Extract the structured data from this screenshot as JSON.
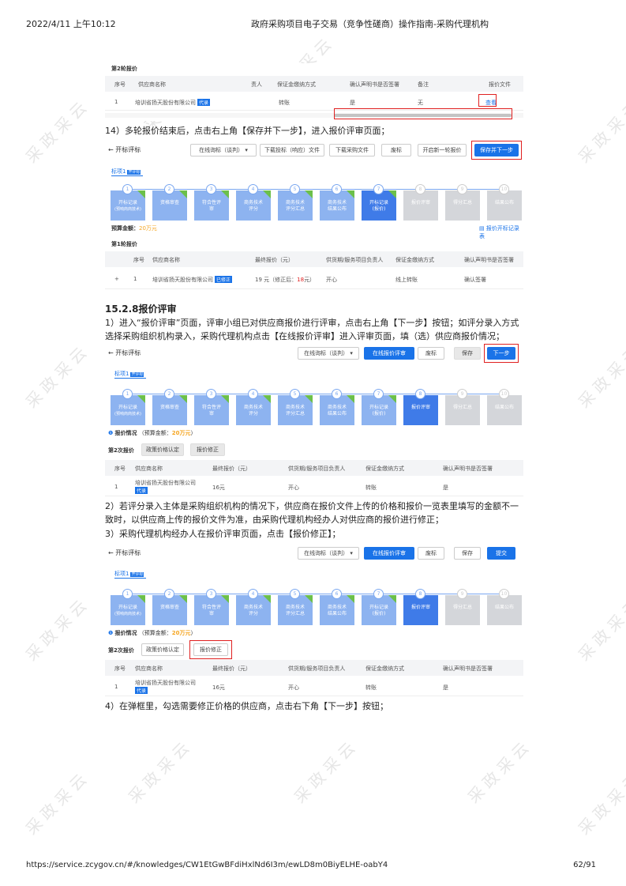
{
  "header": {
    "datetime": "2022/4/11 上午10:12",
    "title": "政府采购项目电子交易（竞争性磋商）操作指南-采购代理机构"
  },
  "footer": {
    "url": "https://service.zcygov.cn/#/knowledges/CW1EtGwBFdiHxlNd6I3m/ewLD8m0BiyELHE-oabY4",
    "page": "62/91"
  },
  "watermark": "采政采云",
  "shot1": {
    "round_label": "第2轮报价",
    "headers": [
      "序号",
      "供应商名称",
      "责人",
      "保证金缴纳方式",
      "确认声明书是否签署",
      "备注",
      "报价文件"
    ],
    "row": {
      "no": "1",
      "supplier": "培训省扬天股份有限公司",
      "tag": "代录",
      "method": "转账",
      "signed": "是",
      "remark": "无",
      "action": "查看"
    }
  },
  "p14": "14）多轮报价结束后，点击右上角【保存并下一步】，进入报价评审页面；",
  "shot2": {
    "back": "开标评标",
    "buttons": [
      "在线询标（谈判）",
      "下载投标（响应）文件",
      "下载采购文件",
      "废标",
      "开启新一轮报价",
      "保存并下一步"
    ],
    "tab": "标项1",
    "tab_badge": "开评标",
    "steps": [
      {
        "n": "1",
        "l1": "开标记录",
        "l2": "(预响商商技术)"
      },
      {
        "n": "2",
        "l1": "资格审查",
        "l2": ""
      },
      {
        "n": "3",
        "l1": "符合性评",
        "l2": "审"
      },
      {
        "n": "4",
        "l1": "商务技术",
        "l2": "评分"
      },
      {
        "n": "5",
        "l1": "商务技术",
        "l2": "评分汇总"
      },
      {
        "n": "6",
        "l1": "商务技术",
        "l2": "结果公布"
      },
      {
        "n": "7",
        "l1": "开标记录",
        "l2": "(报价)"
      },
      {
        "n": "8",
        "l1": "报价评审",
        "l2": ""
      },
      {
        "n": "9",
        "l1": "得分汇总",
        "l2": ""
      },
      {
        "n": "10",
        "l1": "结果公布",
        "l2": ""
      }
    ],
    "budget_label": "预算金额：",
    "budget": "20万元",
    "record_link": "报价开标记录表",
    "round": "第1轮报价",
    "headers": [
      "序号",
      "供应商名称",
      "最终报价（元）",
      "供货期/服务项目负责人",
      "保证金缴纳方式",
      "确认声明书是否签署"
    ],
    "row": {
      "expand": "+",
      "no": "1",
      "supplier": "培训省扬天股份有限公司",
      "tag": "已修正",
      "price": "19 元（修正后：",
      "price_red": "18",
      "price_end": "元）",
      "person": "开心",
      "method": "线上转账",
      "signed": "确认签署"
    }
  },
  "section_title": "15.2.8报价评审",
  "p1": "1）进入“报价评审”页面，评审小组已对供应商报价进行评审，点击右上角【下一步】按钮；如评分录入方式选择采购组织机构录入，采购代理机构点击【在线报价评审】进入评审页面，填（选）供应商报价情况；",
  "shot3": {
    "back": "开标评标",
    "buttons": [
      "在线询标（谈判）",
      "在线报价评审",
      "废标",
      "保存",
      "下一步"
    ],
    "tab": "标项1",
    "tab_badge": "开评标",
    "info_label": "报价情况",
    "budget_text": "（预算金额：",
    "budget": "20万元",
    "budget_end": "）",
    "round": "第2次报价",
    "tabs": [
      "政策价格认定",
      "报价修正"
    ],
    "headers": [
      "序号",
      "供应商名称",
      "最终报价（元）",
      "供货期/服务项目负责人",
      "保证金缴纳方式",
      "确认声明书是否签署"
    ],
    "row": {
      "no": "1",
      "supplier": "培训省扬天股份有限公司",
      "tag": "代录",
      "price": "16元",
      "person": "开心",
      "method": "转账",
      "signed": "是"
    }
  },
  "p2": "2）若评分录入主体是采购组织机构的情况下，供应商在报价文件上传的价格和报价一览表里填写的金额不一致时，以供应商上传的报价文件为准，由采购代理机构经办人对供应商的报价进行修正；",
  "p3": "3）采购代理机构经办人在报价评审页面，点击【报价修正】；",
  "shot4": {
    "back": "开标评标",
    "buttons": [
      "在线询标（谈判）",
      "在线报价评审",
      "废标",
      "保存",
      "提交"
    ],
    "tab": "标项1",
    "tab_badge": "开评标",
    "info_label": "报价情况",
    "budget_text": "（预算金额：",
    "budget": "20万元",
    "budget_end": "）",
    "round": "第2次报价",
    "tabs": [
      "政策价格认定",
      "报价修正"
    ],
    "headers": [
      "序号",
      "供应商名称",
      "最终报价（元）",
      "供货期/服务项目负责人",
      "保证金缴纳方式",
      "确认声明书是否签署"
    ],
    "row": {
      "no": "1",
      "supplier": "培训省扬天股份有限公司",
      "tag": "代录",
      "price": "16元",
      "person": "开心",
      "method": "转账",
      "signed": "是"
    }
  },
  "p4": "4）在弹框里，勾选需要修正价格的供应商，点击右下角【下一步】按钮；",
  "colors": {
    "accent": "#1a73e8",
    "highlight": "#e02020",
    "budget": "#f5a623",
    "done": "#6cc04a"
  }
}
